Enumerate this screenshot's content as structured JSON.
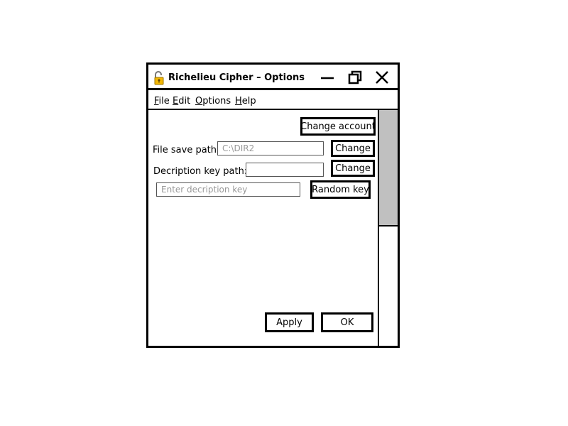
{
  "window": {
    "title": "Richelieu Cipher – Options",
    "app_icon": "padlock-open-icon",
    "controls": {
      "minimize": "minimize-icon",
      "restore": "restore-icon",
      "close": "close-icon"
    }
  },
  "menubar": {
    "items": [
      {
        "accel": "F",
        "rest": "ile"
      },
      {
        "accel": "E",
        "rest": "dit"
      },
      {
        "accel": "O",
        "rest": "ptions"
      },
      {
        "accel": "H",
        "rest": "elp"
      }
    ]
  },
  "options": {
    "change_account_label": "Change account",
    "file_save_path_label": "File save path:",
    "file_save_path_value": "C:\\DIR2",
    "file_change_label": "Change",
    "decription_key_path_label": "Decription key path:",
    "decription_key_path_value": "",
    "key_change_label": "Change",
    "decription_key_placeholder": "Enter decription key",
    "random_key_label": "Random key",
    "apply_label": "Apply",
    "ok_label": "OK"
  }
}
